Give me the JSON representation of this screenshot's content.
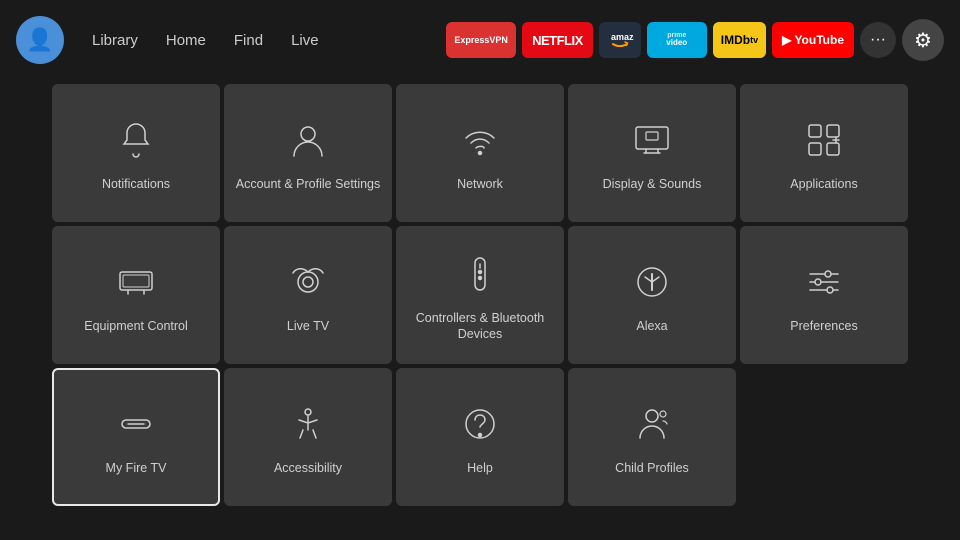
{
  "nav": {
    "library": "Library",
    "home": "Home",
    "find": "Find",
    "live": "Live"
  },
  "apps": [
    {
      "name": "ExpressVPN",
      "class": "app-expressvpn",
      "label": "ExpressVPN"
    },
    {
      "name": "Netflix",
      "class": "app-netflix",
      "label": "NETFLIX"
    },
    {
      "name": "Amazon",
      "class": "app-amazon",
      "label": ""
    },
    {
      "name": "Prime Video",
      "class": "app-prime",
      "label": "prime video"
    },
    {
      "name": "IMDb TV",
      "class": "app-imdb",
      "label": "IMDb tv"
    },
    {
      "name": "YouTube",
      "class": "app-youtube",
      "label": "▶ YouTube"
    }
  ],
  "grid": [
    {
      "id": "notifications",
      "label": "Notifications",
      "icon": "bell",
      "selected": false
    },
    {
      "id": "account",
      "label": "Account & Profile\nSettings",
      "icon": "account",
      "selected": false
    },
    {
      "id": "network",
      "label": "Network",
      "icon": "wifi",
      "selected": false
    },
    {
      "id": "display",
      "label": "Display & Sounds",
      "icon": "display",
      "selected": false
    },
    {
      "id": "applications",
      "label": "Applications",
      "icon": "apps",
      "selected": false
    },
    {
      "id": "equipment",
      "label": "Equipment\nControl",
      "icon": "equipment",
      "selected": false
    },
    {
      "id": "livetv",
      "label": "Live TV",
      "icon": "antenna",
      "selected": false
    },
    {
      "id": "controllers",
      "label": "Controllers & Bluetooth\nDevices",
      "icon": "remote",
      "selected": false
    },
    {
      "id": "alexa",
      "label": "Alexa",
      "icon": "alexa",
      "selected": false
    },
    {
      "id": "preferences",
      "label": "Preferences",
      "icon": "sliders",
      "selected": false
    },
    {
      "id": "myfiretv",
      "label": "My Fire TV",
      "icon": "firetv",
      "selected": true
    },
    {
      "id": "accessibility",
      "label": "Accessibility",
      "icon": "accessibility",
      "selected": false
    },
    {
      "id": "help",
      "label": "Help",
      "icon": "help",
      "selected": false
    },
    {
      "id": "childprofiles",
      "label": "Child Profiles",
      "icon": "childprofiles",
      "selected": false
    }
  ]
}
